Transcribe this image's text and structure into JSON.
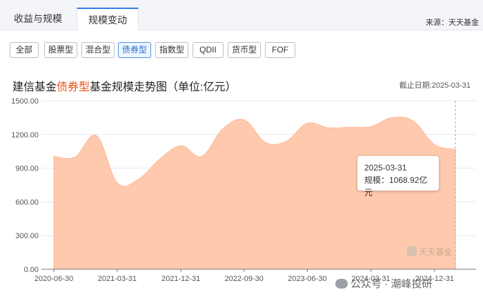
{
  "tabs": [
    {
      "label": "收益与规模"
    },
    {
      "label": "规模变动"
    }
  ],
  "source_text": "来源：天天基金",
  "filters": [
    {
      "label": "全部"
    },
    {
      "label": "股票型"
    },
    {
      "label": "混合型"
    },
    {
      "label": "债券型"
    },
    {
      "label": "指数型"
    },
    {
      "label": "QDII"
    },
    {
      "label": "货币型"
    },
    {
      "label": "FOF"
    }
  ],
  "active_filter": "债券型",
  "title": {
    "prefix": "建信基金",
    "highlight": "债券型",
    "suffix": "基金规模走势图（单位:亿元）"
  },
  "cutoff_date": "截止日期:2025-03-31",
  "tooltip": {
    "date": "2025-03-31",
    "value": "规模：1068.92亿元"
  },
  "watermark": {
    "brand": "天天基金",
    "caption": "公众号 · 潮峰投研"
  },
  "colors": {
    "area": "#ffc9ad",
    "accent": "#e8541c",
    "active": "#4a8fe4"
  },
  "chart_data": {
    "type": "area",
    "title": "建信基金债券型基金规模走势图（单位:亿元）",
    "xlabel": "",
    "ylabel": "",
    "ylim": [
      0,
      1500
    ],
    "yticks": [
      "0.00",
      "300.00",
      "600.00",
      "900.00",
      "1200.00",
      "1500.00"
    ],
    "xticks": [
      "2020-06-30",
      "2021-03-31",
      "2021-12-31",
      "2022-09-30",
      "2023-06-30",
      "2024-03-31",
      "2024-12-31"
    ],
    "grid": true,
    "x": [
      "2020-06-30",
      "2020-09-30",
      "2020-12-31",
      "2021-03-31",
      "2021-06-30",
      "2021-09-30",
      "2021-12-31",
      "2022-03-31",
      "2022-06-30",
      "2022-09-30",
      "2022-12-31",
      "2023-03-31",
      "2023-06-30",
      "2023-09-30",
      "2023-12-31",
      "2024-03-31",
      "2024-06-30",
      "2024-09-30",
      "2024-12-31",
      "2025-03-31"
    ],
    "values": [
      1005,
      1000,
      1190,
      770,
      800,
      980,
      1100,
      1005,
      1250,
      1330,
      1130,
      1140,
      1300,
      1260,
      1265,
      1270,
      1350,
      1320,
      1110,
      1068.92
    ]
  }
}
